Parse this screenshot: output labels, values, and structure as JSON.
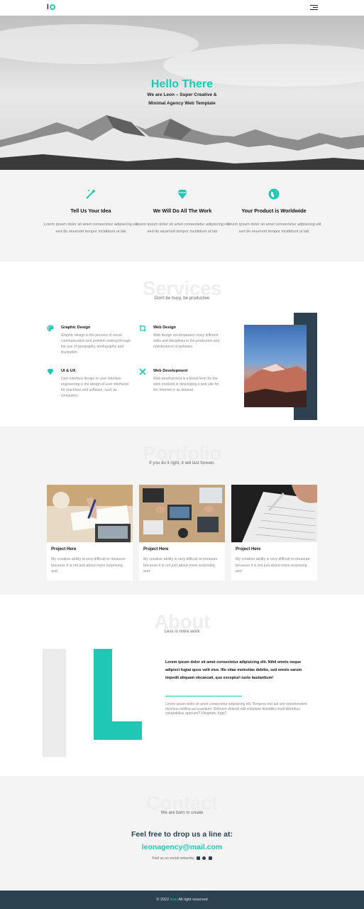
{
  "nav": {
    "logo_text": "l",
    "menu_icon": "hamburger-icon"
  },
  "hero": {
    "title": "Hello There",
    "subtitle_line1": "We are Leon – Super Creative &",
    "subtitle_line2": "Minimal Agency Web Template"
  },
  "features": [
    {
      "icon": "magic-wand-icon",
      "title": "Tell Us Your Idea",
      "text": "Lorem ipsum dolor sit amet consectetur adipiscing elit sed do eiusmod tempor incididunt ut lab"
    },
    {
      "icon": "diamond-icon",
      "title": "We Will Do All The Work",
      "text": "Lorem ipsum dolor sit amet consectetur adipiscing elit sed do eiusmod tempor incididunt ut lab"
    },
    {
      "icon": "globe-icon",
      "title": "Your Product is Worldwide",
      "text": "Lorem ipsum dolor sit amet consectetur adipiscing elit sed do eiusmod tempor incididunt ut lab"
    }
  ],
  "services": {
    "bg_word": "Services",
    "subtitle": "Don't be busy, be productive",
    "items": [
      {
        "icon": "palette-icon",
        "title": "Graphic Design",
        "text": "Graphic design is the process of visual communication and problem solving through the use of typography, photography and illustration."
      },
      {
        "icon": "crop-icon",
        "title": "Web Design",
        "text": "Web design encompasses many different skills and disciplines in the production and maintenance of websites."
      },
      {
        "icon": "diamond-icon",
        "title": "UI & UX",
        "text": "User interface design or user interface engineering is the design of user interfaces for machines and software, such as computers."
      },
      {
        "icon": "tools-icon",
        "title": "Web Development",
        "text": "Web development is a broad term for the work involved in developing a web site for the Internet or an intranet."
      }
    ]
  },
  "portfolio": {
    "bg_word": "Portfolio",
    "subtitle": "If you do it right, it will last forever.",
    "cards": [
      {
        "title": "Project Here",
        "text": "My creative ability is very difficult to measure because it is not just about more surprising and"
      },
      {
        "title": "Project Here",
        "text": "My creative ability is very difficult to measure because it is not just about more surprising and"
      },
      {
        "title": "Project Here",
        "text": "My creative ability is very difficult to measure because it is not just about more surprising and"
      }
    ]
  },
  "about": {
    "bg_word": "About",
    "subtitle": "Less is more work",
    "bold_text": "Lorem ipsum dolor sit amet consectetur adipisicing elit. Nihil omnis neque adipisci fugiat quos velit eius. Illo vitae molestiae debitis, sed omnis earum impedit aliquam obcaecati, quo excepturi iusto laudantium!",
    "body_text": "Lorem ipsum dolor sit amet consectetur adipisicing elit. Tempora nisi aut sint reprehenderit ducimus mollitia accusantium. Dolorem deleniti odit voluptate blanditiis modi doloribus voluptatibus aperiam? Voluptate, fuga?"
  },
  "contact": {
    "bg_word": "Contact",
    "subtitle": "We are born to create",
    "line": "Feel free to drop us a line at:",
    "email": "leonagency@mail.com",
    "social_label": "Find us on social networks"
  },
  "footer": {
    "prefix": "© 2022 ",
    "brand": "leon",
    "suffix": " All right reserved"
  },
  "colors": {
    "accent": "#1ec8b4",
    "dark": "#2c4251",
    "light_bg": "#f4f4f4"
  }
}
